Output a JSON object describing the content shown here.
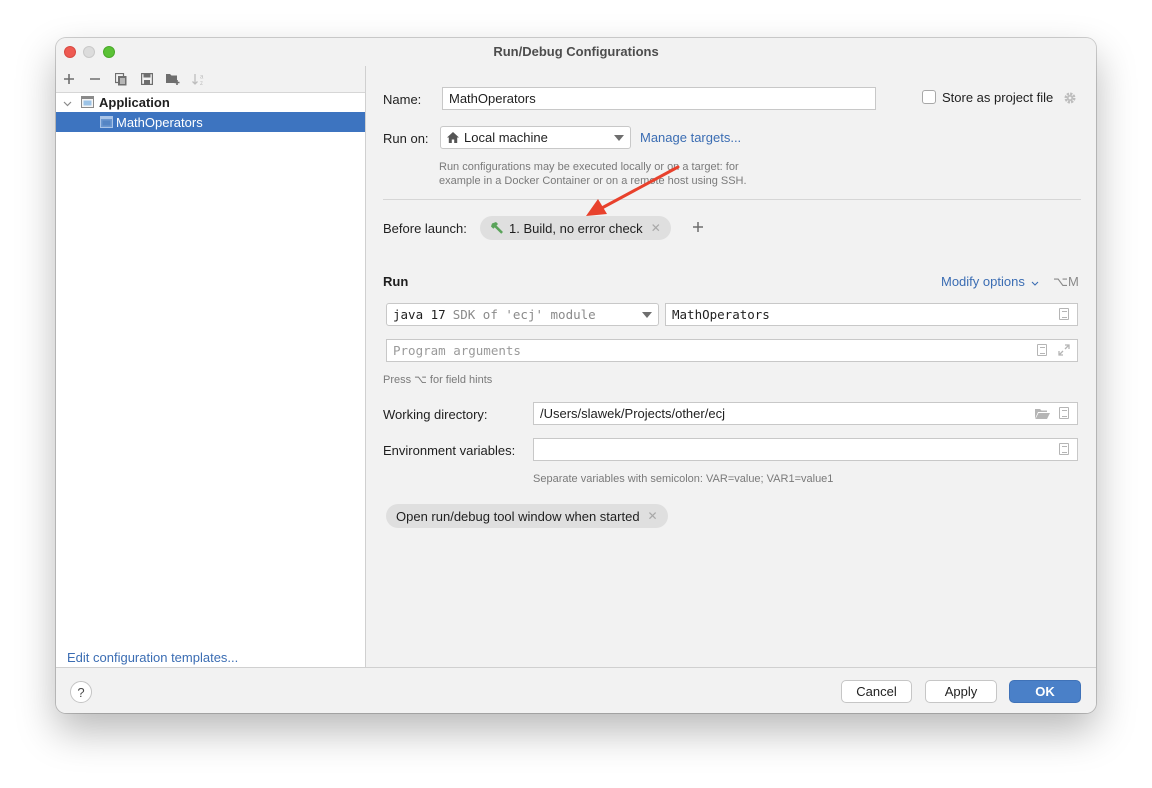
{
  "window": {
    "title": "Run/Debug Configurations"
  },
  "sidebar": {
    "toolbar": [
      "add-icon",
      "remove-icon",
      "copy-icon",
      "save-icon",
      "new-folder-icon",
      "sort-icon"
    ],
    "tree": [
      {
        "label": "Application",
        "expanded": true,
        "level": 0
      },
      {
        "label": "MathOperators",
        "selected": true,
        "level": 1
      }
    ],
    "edit_templates_link": "Edit configuration templates..."
  },
  "form": {
    "name_label": "Name:",
    "name_value": "MathOperators",
    "store_as_project_file_label": "Store as project file",
    "store_as_project_file_checked": false,
    "run_on_label": "Run on:",
    "run_on_value": "Local machine",
    "manage_targets_link": "Manage targets...",
    "run_on_hint_line1": "Run configurations may be executed locally or on a target: for",
    "run_on_hint_line2": "example in a Docker Container or on a remote host using SSH.",
    "before_launch_label": "Before launch:",
    "before_launch_task": "1. Build, no error check",
    "add_task_label": "+",
    "run_section_title": "Run",
    "modify_options_link": "Modify options",
    "modify_options_shortcut": "⌥M",
    "jdk_value": "java 17",
    "jdk_detail": "SDK of 'ecj' module",
    "main_class_value": "MathOperators",
    "program_args_placeholder": "Program arguments",
    "field_hints": "Press ⌥ for field hints",
    "working_dir_label": "Working directory:",
    "working_dir_value": "/Users/slawek/Projects/other/ecj",
    "env_vars_label": "Environment variables:",
    "env_vars_value": "",
    "env_vars_hint": "Separate variables with semicolon: VAR=value; VAR1=value1",
    "option_chip": "Open run/debug tool window when started"
  },
  "footer": {
    "help_label": "?",
    "cancel_label": "Cancel",
    "apply_label": "Apply",
    "ok_label": "OK"
  },
  "annotation": {
    "arrow_color": "#e8412c"
  },
  "colors": {
    "accent": "#3d74c0",
    "link": "#3b6db3",
    "ok_button": "#4a80c8"
  }
}
